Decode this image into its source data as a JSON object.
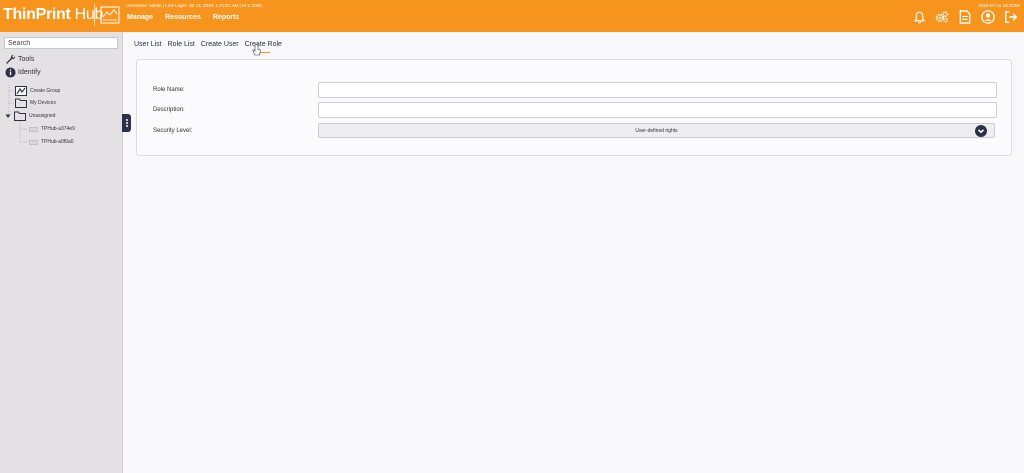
{
  "header": {
    "logo_main": "ThinPrint",
    "logo_hub": " Hub",
    "session_info": "Username: admin | Last Login: Jul 12, 2019, 1:41:57 AM |   v4.2.1006",
    "datetime": "2019-07-11 19:30:04",
    "nav": [
      "Manage",
      "Resources",
      "Reports"
    ],
    "icons": [
      "bell-icon",
      "gears-icon",
      "document-icon",
      "user-icon",
      "logout-icon"
    ]
  },
  "sidebar": {
    "search_placeholder": "Search",
    "tools_label": "Tools",
    "identify_label": "Identify",
    "tree": {
      "create_group": "Create Group",
      "my_devices": "My Devices",
      "unassigned": "Unassigned",
      "devices": [
        "TPHub-a374e9",
        "TPHub-a0f9a0"
      ]
    }
  },
  "tabs": [
    "User List",
    "Role List",
    "Create User",
    "Create Role"
  ],
  "active_tab": "Create Role",
  "form": {
    "role_name_label": "Role Name:",
    "role_name_value": "",
    "description_label": "Description:",
    "description_value": "",
    "security_level_label": "Security Level:",
    "security_level_value": "User-defined rights"
  },
  "colors": {
    "accent": "#f7941d",
    "dark": "#2b3147",
    "sidebar_bg": "#e3e1e4",
    "page_bg": "#f8f7f9"
  }
}
